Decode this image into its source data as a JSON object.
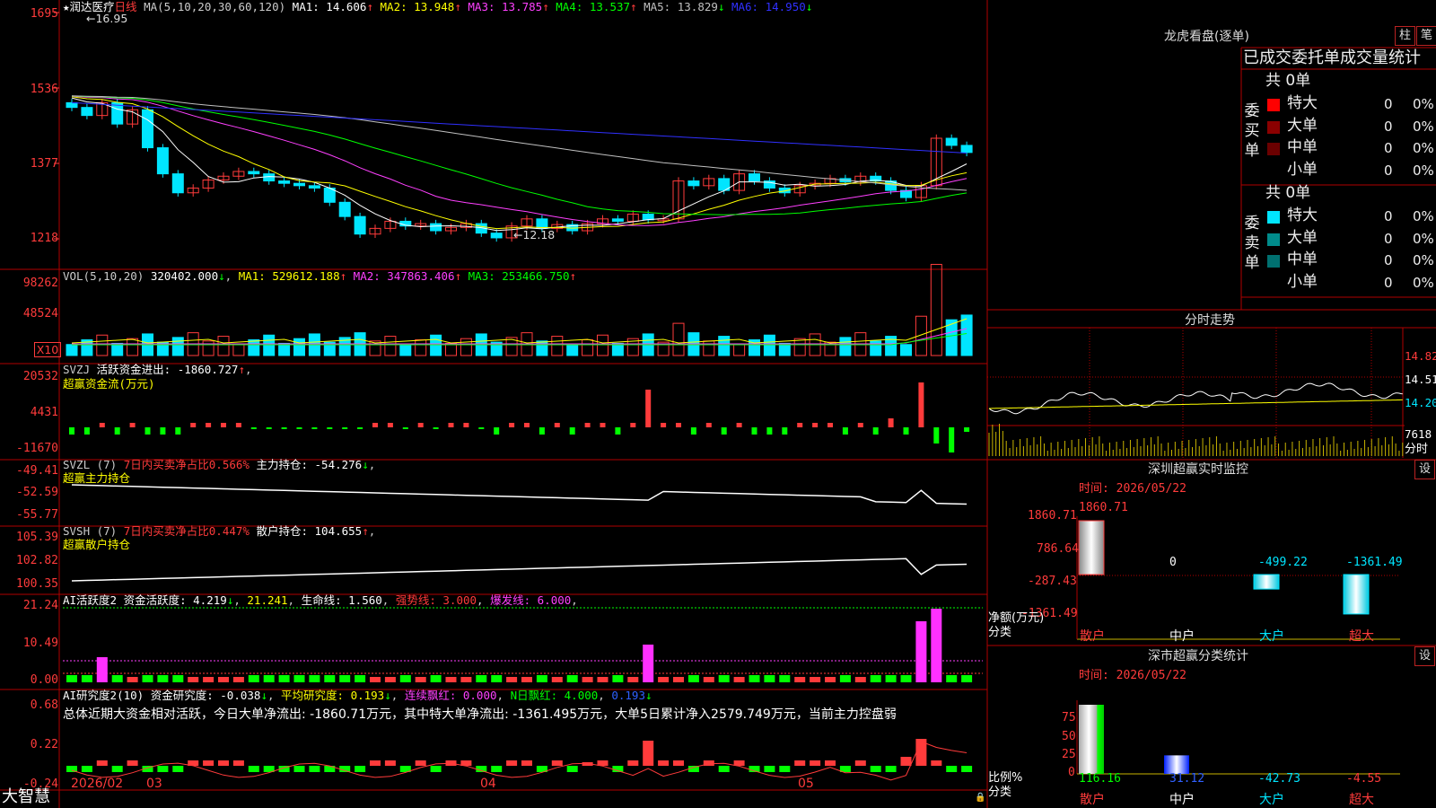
{
  "app": {
    "brand": "大智慧"
  },
  "stock": {
    "star": "★",
    "name": "润达医疗",
    "period": "日线",
    "ma_head": "MA(5,10,20,30,60,120)",
    "ma": [
      {
        "label": "MA1:",
        "value": "14.606",
        "arrow": "↑",
        "color": "#ffffff"
      },
      {
        "label": "MA2:",
        "value": "13.948",
        "arrow": "↑",
        "color": "#ffff00"
      },
      {
        "label": "MA3:",
        "value": "13.785",
        "arrow": "↑",
        "color": "#ff40ff"
      },
      {
        "label": "MA4:",
        "value": "13.537",
        "arrow": "↑",
        "color": "#00ff00"
      },
      {
        "label": "MA5:",
        "value": "13.829",
        "arrow": "↓",
        "color": "#c0c0c0"
      },
      {
        "label": "MA6:",
        "value": "14.950",
        "arrow": "↓",
        "color": "#3030ff"
      }
    ],
    "high_marker": "16.95",
    "low_marker": "←12.18",
    "price_axis": [
      "1695",
      "1536",
      "1377",
      "1218"
    ]
  },
  "volume": {
    "head": "VOL(5,10,20)",
    "value": "320402.000",
    "value_arrow": "↓",
    "ma": [
      {
        "label": "MA1:",
        "value": "529612.188",
        "arrow": "↑",
        "color": "#ffff00"
      },
      {
        "label": "MA2:",
        "value": "347863.406",
        "arrow": "↑",
        "color": "#ff40ff"
      },
      {
        "label": "MA3:",
        "value": "253466.750",
        "arrow": "↑",
        "color": "#00ff00"
      }
    ],
    "axis": [
      "98262",
      "48524"
    ],
    "unit": "X10"
  },
  "svzj": {
    "head": "SVZJ",
    "text": "活跃资金进出: -1860.727",
    "arrow": "↑",
    "subtitle": "超赢资金流(万元)",
    "axis": [
      "20532",
      "4431",
      "-11670"
    ]
  },
  "svzl": {
    "head": "SVZL (7)",
    "red_text": "7日内买卖净占比0.566%",
    "text": "主力持仓: -54.276",
    "arrow": "↓",
    "subtitle": "超赢主力持仓",
    "axis": [
      "-49.41",
      "-52.59",
      "-55.77"
    ]
  },
  "svsh": {
    "head": "SVSH (7)",
    "red_text": "7日内买卖净占比0.447%",
    "text": "散户持仓: 104.655",
    "arrow": "↑",
    "subtitle": "超赢散户持仓",
    "axis": [
      "105.39",
      "102.82",
      "100.35"
    ]
  },
  "ai_active": {
    "head": "AI活跃度2",
    "text1": "资金活跃度: 4.219",
    "text1_arrow": "↓",
    "text2": "21.241",
    "text3": "生命线: 1.560",
    "text4": "强势线: 3.000",
    "text5": "爆发线: 6.000",
    "axis": [
      "21.24",
      "10.49",
      "0.00"
    ]
  },
  "ai_research": {
    "head": "AI研究度2(10)",
    "text1": "资金研究度: -0.038",
    "text1_arrow": "↓",
    "text2": "平均研究度: 0.193",
    "text2_arrow": "↓",
    "text3": "连续飘红: 0.000",
    "text4": "N日飘红: 4.000",
    "text5": "0.193",
    "text5_arrow": "↓",
    "summary": "总体近期大资金相对活跃，今日大单净流出: -1860.71万元，其中特大单净流出: -1361.495万元，大单5日累计净入2579.749万元，当前主力控盘弱",
    "axis": [
      "0.68",
      "0.22",
      "-0.24"
    ]
  },
  "dates": [
    "2026/02",
    "03",
    "04",
    "05"
  ],
  "dragon": {
    "title": "龙虎看盘(逐单)",
    "btn_bar": "柱",
    "btn_list": "笔",
    "header": "已成交委托单成交量统计",
    "buy_label": "委买单",
    "sell_label": "委卖单",
    "buy_total": "共 0单",
    "sell_total": "共 0单",
    "buy_rows": [
      {
        "label": "特大",
        "count": "0",
        "pct": "0%",
        "color": "#ff0000"
      },
      {
        "label": "大单",
        "count": "0",
        "pct": "0%",
        "color": "#8b0000"
      },
      {
        "label": "中单",
        "count": "0",
        "pct": "0%",
        "color": "#6b0000"
      },
      {
        "label": "小单",
        "count": "0",
        "pct": "0%",
        "color": "#000000"
      }
    ],
    "sell_rows": [
      {
        "label": "特大",
        "count": "0",
        "pct": "0%",
        "color": "#00e5ff"
      },
      {
        "label": "大单",
        "count": "0",
        "pct": "0%",
        "color": "#008b8b"
      },
      {
        "label": "中单",
        "count": "0",
        "pct": "0%",
        "color": "#007070"
      },
      {
        "label": "小单",
        "count": "0",
        "pct": "0%",
        "color": "#000000"
      }
    ]
  },
  "intraday": {
    "title": "分时走势",
    "axis": [
      "14.82",
      "14.51",
      "14.20"
    ],
    "vol_axis": "7618",
    "vol_label": "分时"
  },
  "monitor": {
    "title": "深圳超赢实时监控",
    "btn": "设",
    "time": "时间: 2026/05/22",
    "axis": [
      "1860.71",
      "786.64",
      "-287.43",
      "-1361.49"
    ],
    "unit": "净额(万元)",
    "cat_label": "分类",
    "categories": [
      "散户",
      "中户",
      "大户",
      "超大"
    ],
    "values": [
      1860.71,
      0,
      -499.22,
      -1361.49
    ],
    "value_labels": [
      "1860.71",
      "0",
      "-499.22",
      "-1361.49"
    ]
  },
  "classify": {
    "title": "深市超赢分类统计",
    "btn": "设",
    "time": "时间: 2026/05/22",
    "axis": [
      "75",
      "50",
      "25",
      "0"
    ],
    "unit": "比例%",
    "cat_label": "分类",
    "categories": [
      "散户",
      "中户",
      "大户",
      "超大"
    ],
    "values": [
      116.16,
      31.12,
      -42.73,
      -4.55
    ],
    "value_labels": [
      "116.16",
      "31.12",
      "-42.73",
      "-4.55"
    ]
  },
  "colors": {
    "up": "#ff3b3b",
    "down": "#00e5ff",
    "grid": "#b00000",
    "accent": "#ffff00"
  }
}
